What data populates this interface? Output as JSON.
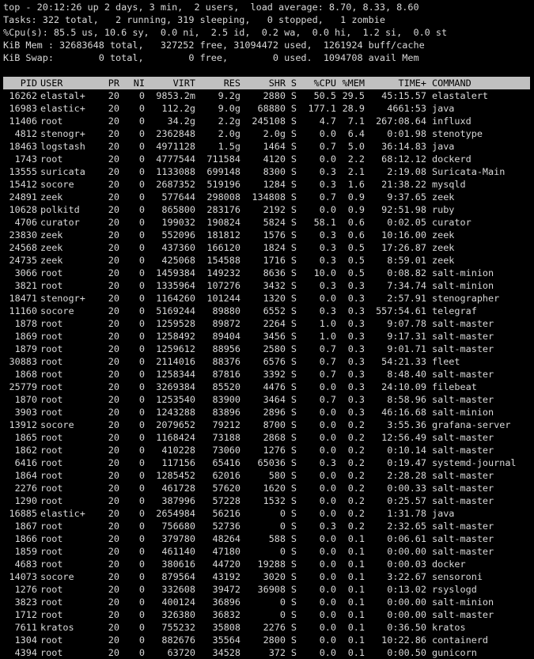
{
  "summary": {
    "line1": "top - 20:12:26 up 2 days, 3 min,  2 users,  load average: 8.70, 8.33, 8.60",
    "line2": "Tasks: 322 total,   2 running, 319 sleeping,   0 stopped,   1 zombie",
    "line3": "%Cpu(s): 85.5 us, 10.6 sy,  0.0 ni,  2.5 id,  0.2 wa,  0.0 hi,  1.2 si,  0.0 st",
    "line4": "KiB Mem : 32683648 total,   327252 free, 31094472 used,  1261924 buff/cache",
    "line5": "KiB Swap:        0 total,        0 free,        0 used.  1094708 avail Mem"
  },
  "columns": {
    "pid": "PID",
    "user": "USER",
    "pr": "PR",
    "ni": "NI",
    "virt": "VIRT",
    "res": "RES",
    "shr": "SHR",
    "s": "S",
    "cpu": "%CPU",
    "mem": "%MEM",
    "time": "TIME+",
    "command": "COMMAND"
  },
  "processes": [
    [
      "16262",
      "elastal+",
      "20",
      "0",
      "9853.2m",
      "9.2g",
      "2880",
      "S",
      "50.5",
      "29.5",
      "45:15.57",
      "elastalert"
    ],
    [
      "16983",
      "elastic+",
      "20",
      "0",
      "112.2g",
      "9.0g",
      "68880",
      "S",
      "177.1",
      "28.9",
      "4661:53",
      "java"
    ],
    [
      "11406",
      "root",
      "20",
      "0",
      "34.2g",
      "2.2g",
      "245108",
      "S",
      "4.7",
      "7.1",
      "267:08.64",
      "influxd"
    ],
    [
      "4812",
      "stenogr+",
      "20",
      "0",
      "2362848",
      "2.0g",
      "2.0g",
      "S",
      "0.0",
      "6.4",
      "0:01.98",
      "stenotype"
    ],
    [
      "18463",
      "logstash",
      "20",
      "0",
      "4971128",
      "1.5g",
      "1464",
      "S",
      "0.7",
      "5.0",
      "36:14.83",
      "java"
    ],
    [
      "1743",
      "root",
      "20",
      "0",
      "4777544",
      "711584",
      "4120",
      "S",
      "0.0",
      "2.2",
      "68:12.12",
      "dockerd"
    ],
    [
      "13555",
      "suricata",
      "20",
      "0",
      "1133088",
      "699148",
      "8300",
      "S",
      "0.3",
      "2.1",
      "2:19.08",
      "Suricata-Main"
    ],
    [
      "15412",
      "socore",
      "20",
      "0",
      "2687352",
      "519196",
      "1284",
      "S",
      "0.3",
      "1.6",
      "21:38.22",
      "mysqld"
    ],
    [
      "24891",
      "zeek",
      "20",
      "0",
      "577644",
      "298008",
      "134808",
      "S",
      "0.7",
      "0.9",
      "9:37.65",
      "zeek"
    ],
    [
      "10628",
      "polkitd",
      "20",
      "0",
      "865800",
      "283176",
      "2192",
      "S",
      "0.0",
      "0.9",
      "92:51.98",
      "ruby"
    ],
    [
      "4706",
      "curator",
      "20",
      "0",
      "199032",
      "190824",
      "5824",
      "S",
      "58.1",
      "0.6",
      "0:02.05",
      "curator"
    ],
    [
      "23830",
      "zeek",
      "20",
      "0",
      "552096",
      "181812",
      "1576",
      "S",
      "0.3",
      "0.6",
      "10:16.00",
      "zeek"
    ],
    [
      "24568",
      "zeek",
      "20",
      "0",
      "437360",
      "166120",
      "1824",
      "S",
      "0.3",
      "0.5",
      "17:26.87",
      "zeek"
    ],
    [
      "24735",
      "zeek",
      "20",
      "0",
      "425068",
      "154588",
      "1716",
      "S",
      "0.3",
      "0.5",
      "8:59.01",
      "zeek"
    ],
    [
      "3066",
      "root",
      "20",
      "0",
      "1459384",
      "149232",
      "8636",
      "S",
      "10.0",
      "0.5",
      "0:08.82",
      "salt-minion"
    ],
    [
      "3821",
      "root",
      "20",
      "0",
      "1335964",
      "107276",
      "3432",
      "S",
      "0.3",
      "0.3",
      "7:34.74",
      "salt-minion"
    ],
    [
      "18471",
      "stenogr+",
      "20",
      "0",
      "1164260",
      "101244",
      "1320",
      "S",
      "0.0",
      "0.3",
      "2:57.91",
      "stenographer"
    ],
    [
      "11160",
      "socore",
      "20",
      "0",
      "5169244",
      "89880",
      "6552",
      "S",
      "0.3",
      "0.3",
      "557:54.61",
      "telegraf"
    ],
    [
      "1878",
      "root",
      "20",
      "0",
      "1259528",
      "89872",
      "2264",
      "S",
      "1.0",
      "0.3",
      "9:07.78",
      "salt-master"
    ],
    [
      "1869",
      "root",
      "20",
      "0",
      "1258492",
      "89404",
      "3456",
      "S",
      "1.0",
      "0.3",
      "9:17.31",
      "salt-master"
    ],
    [
      "1879",
      "root",
      "20",
      "0",
      "1259612",
      "88956",
      "2580",
      "S",
      "0.7",
      "0.3",
      "9:01.71",
      "salt-master"
    ],
    [
      "30883",
      "root",
      "20",
      "0",
      "2114016",
      "88376",
      "6576",
      "S",
      "0.7",
      "0.3",
      "54:21.33",
      "fleet"
    ],
    [
      "1868",
      "root",
      "20",
      "0",
      "1258344",
      "87816",
      "3392",
      "S",
      "0.7",
      "0.3",
      "8:48.40",
      "salt-master"
    ],
    [
      "25779",
      "root",
      "20",
      "0",
      "3269384",
      "85520",
      "4476",
      "S",
      "0.0",
      "0.3",
      "24:10.09",
      "filebeat"
    ],
    [
      "1870",
      "root",
      "20",
      "0",
      "1253540",
      "83900",
      "3464",
      "S",
      "0.7",
      "0.3",
      "8:58.96",
      "salt-master"
    ],
    [
      "3903",
      "root",
      "20",
      "0",
      "1243288",
      "83896",
      "2896",
      "S",
      "0.0",
      "0.3",
      "46:16.68",
      "salt-minion"
    ],
    [
      "13912",
      "socore",
      "20",
      "0",
      "2079652",
      "79212",
      "8700",
      "S",
      "0.0",
      "0.2",
      "3:55.36",
      "grafana-server"
    ],
    [
      "1865",
      "root",
      "20",
      "0",
      "1168424",
      "73188",
      "2868",
      "S",
      "0.0",
      "0.2",
      "12:56.49",
      "salt-master"
    ],
    [
      "1862",
      "root",
      "20",
      "0",
      "410228",
      "73060",
      "1276",
      "S",
      "0.0",
      "0.2",
      "0:10.14",
      "salt-master"
    ],
    [
      "6416",
      "root",
      "20",
      "0",
      "117156",
      "65416",
      "65036",
      "S",
      "0.3",
      "0.2",
      "0:19.47",
      "systemd-journal"
    ],
    [
      "1864",
      "root",
      "20",
      "0",
      "1285452",
      "62016",
      "580",
      "S",
      "0.0",
      "0.2",
      "2:28.28",
      "salt-master"
    ],
    [
      "2276",
      "root",
      "20",
      "0",
      "461728",
      "57620",
      "1620",
      "S",
      "0.0",
      "0.2",
      "0:00.33",
      "salt-master"
    ],
    [
      "1290",
      "root",
      "20",
      "0",
      "387996",
      "57228",
      "1532",
      "S",
      "0.0",
      "0.2",
      "0:25.57",
      "salt-master"
    ],
    [
      "16885",
      "elastic+",
      "20",
      "0",
      "2654984",
      "56216",
      "0",
      "S",
      "0.0",
      "0.2",
      "1:31.78",
      "java"
    ],
    [
      "1867",
      "root",
      "20",
      "0",
      "756680",
      "52736",
      "0",
      "S",
      "0.3",
      "0.2",
      "2:32.65",
      "salt-master"
    ],
    [
      "1866",
      "root",
      "20",
      "0",
      "379780",
      "48264",
      "588",
      "S",
      "0.0",
      "0.1",
      "0:06.61",
      "salt-master"
    ],
    [
      "1859",
      "root",
      "20",
      "0",
      "461140",
      "47180",
      "0",
      "S",
      "0.0",
      "0.1",
      "0:00.00",
      "salt-master"
    ],
    [
      "4683",
      "root",
      "20",
      "0",
      "380616",
      "44720",
      "19288",
      "S",
      "0.0",
      "0.1",
      "0:00.03",
      "docker"
    ],
    [
      "14073",
      "socore",
      "20",
      "0",
      "879564",
      "43192",
      "3020",
      "S",
      "0.0",
      "0.1",
      "3:22.67",
      "sensoroni"
    ],
    [
      "1276",
      "root",
      "20",
      "0",
      "332608",
      "39472",
      "36908",
      "S",
      "0.0",
      "0.1",
      "0:13.02",
      "rsyslogd"
    ],
    [
      "3823",
      "root",
      "20",
      "0",
      "400124",
      "36896",
      "0",
      "S",
      "0.0",
      "0.1",
      "0:00.00",
      "salt-minion"
    ],
    [
      "1712",
      "root",
      "20",
      "0",
      "326380",
      "36832",
      "0",
      "S",
      "0.0",
      "0.1",
      "0:00.00",
      "salt-master"
    ],
    [
      "7611",
      "kratos",
      "20",
      "0",
      "755232",
      "35808",
      "2276",
      "S",
      "0.0",
      "0.1",
      "0:36.50",
      "kratos"
    ],
    [
      "1304",
      "root",
      "20",
      "0",
      "882676",
      "35564",
      "2800",
      "S",
      "0.0",
      "0.1",
      "10:22.86",
      "containerd"
    ],
    [
      "4394",
      "root",
      "20",
      "0",
      "63720",
      "34528",
      "372",
      "S",
      "0.0",
      "0.1",
      "0:00.50",
      "gunicorn"
    ]
  ],
  "colors": {
    "background": "#000000",
    "text": "#d8d8d8",
    "header_bg": "#c0c0c0",
    "header_text": "#000000"
  }
}
